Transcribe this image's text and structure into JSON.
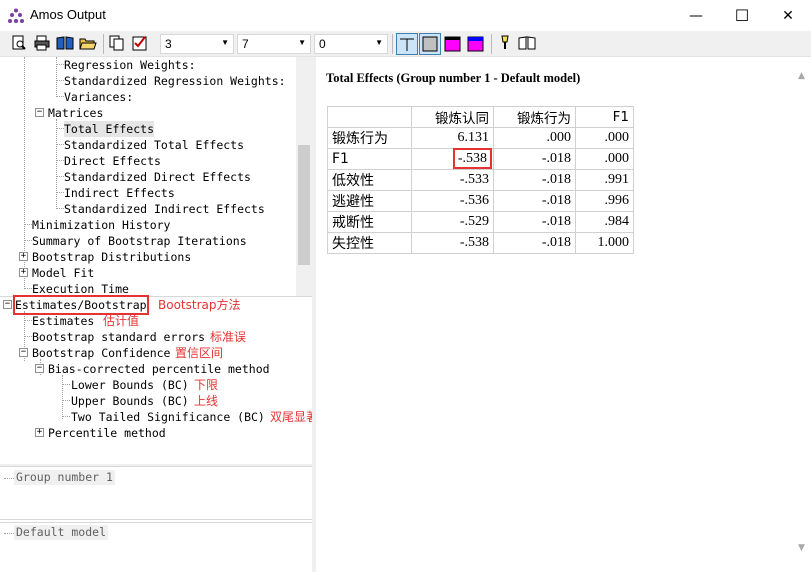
{
  "window": {
    "title": "Amos Output",
    "minimize_glyph": "—",
    "maximize_glyph": "☐",
    "close_glyph": "✕"
  },
  "toolbar": {
    "icons": [
      "print-preview-icon",
      "print-icon",
      "book-icon",
      "open-folder-icon",
      "copy-icon",
      "checklist-icon",
      "grid-lines-icon",
      "gray-box-icon",
      "magenta-box-icon",
      "magenta-blue-box-icon",
      "lamp-icon",
      "book-help-icon"
    ],
    "combo1": {
      "value": "3"
    },
    "combo2": {
      "value": "7"
    },
    "combo3": {
      "value": "0"
    },
    "swatch_colors": [
      "#c0c0c0",
      "#ff00ff",
      "#0000ff"
    ]
  },
  "tree": {
    "items": [
      {
        "label": "Regression Weights:"
      },
      {
        "label": "Standardized Regression Weights:"
      },
      {
        "label": "Variances:"
      },
      {
        "label": "Matrices"
      },
      {
        "label": "Total Effects"
      },
      {
        "label": "Standardized Total Effects"
      },
      {
        "label": "Direct Effects"
      },
      {
        "label": "Standardized Direct Effects"
      },
      {
        "label": "Indirect Effects"
      },
      {
        "label": "Standardized Indirect Effects"
      },
      {
        "label": "Minimization History"
      },
      {
        "label": "Summary of Bootstrap Iterations"
      },
      {
        "label": "Bootstrap Distributions"
      },
      {
        "label": "Model Fit"
      },
      {
        "label": "Execution Time"
      }
    ]
  },
  "tree2": {
    "items": [
      {
        "label": "Estimates/Bootstrap",
        "annotation": "Bootstrap方法"
      },
      {
        "label": "Estimates",
        "annotation": "估计值"
      },
      {
        "label": "Bootstrap standard errors",
        "annotation": "标准误"
      },
      {
        "label": "Bootstrap Confidence",
        "annotation": "置信区间"
      },
      {
        "label": "Bias-corrected percentile method",
        "annotation": ""
      },
      {
        "label": "Lower Bounds (BC)",
        "annotation": "下限"
      },
      {
        "label": "Upper Bounds (BC)",
        "annotation": "上线"
      },
      {
        "label": "Two Tailed Significance (BC)",
        "annotation": "双尾显著性"
      },
      {
        "label": "Percentile method",
        "annotation": ""
      }
    ]
  },
  "group_pane": {
    "label": "Group number 1"
  },
  "model_pane": {
    "label": "Default model"
  },
  "content": {
    "title": "Total Effects (Group number 1 - Default model)",
    "table": {
      "columns": [
        "",
        "锻炼认同",
        "锻炼行为",
        "F1"
      ],
      "rows": [
        {
          "label": "锻炼行为",
          "values": [
            "6.131",
            ".000",
            ".000"
          ]
        },
        {
          "label": "F1",
          "values": [
            "-.538",
            "-.018",
            ".000"
          ]
        },
        {
          "label": "低效性",
          "values": [
            "-.533",
            "-.018",
            ".991"
          ]
        },
        {
          "label": "逃避性",
          "values": [
            "-.536",
            "-.018",
            ".996"
          ]
        },
        {
          "label": "戒断性",
          "values": [
            "-.529",
            "-.018",
            ".984"
          ]
        },
        {
          "label": "失控性",
          "values": [
            "-.538",
            "-.018",
            "1.000"
          ]
        }
      ]
    }
  },
  "colors": {
    "highlight": "#e53333",
    "toolbar_bg": "#f0f0f0"
  }
}
